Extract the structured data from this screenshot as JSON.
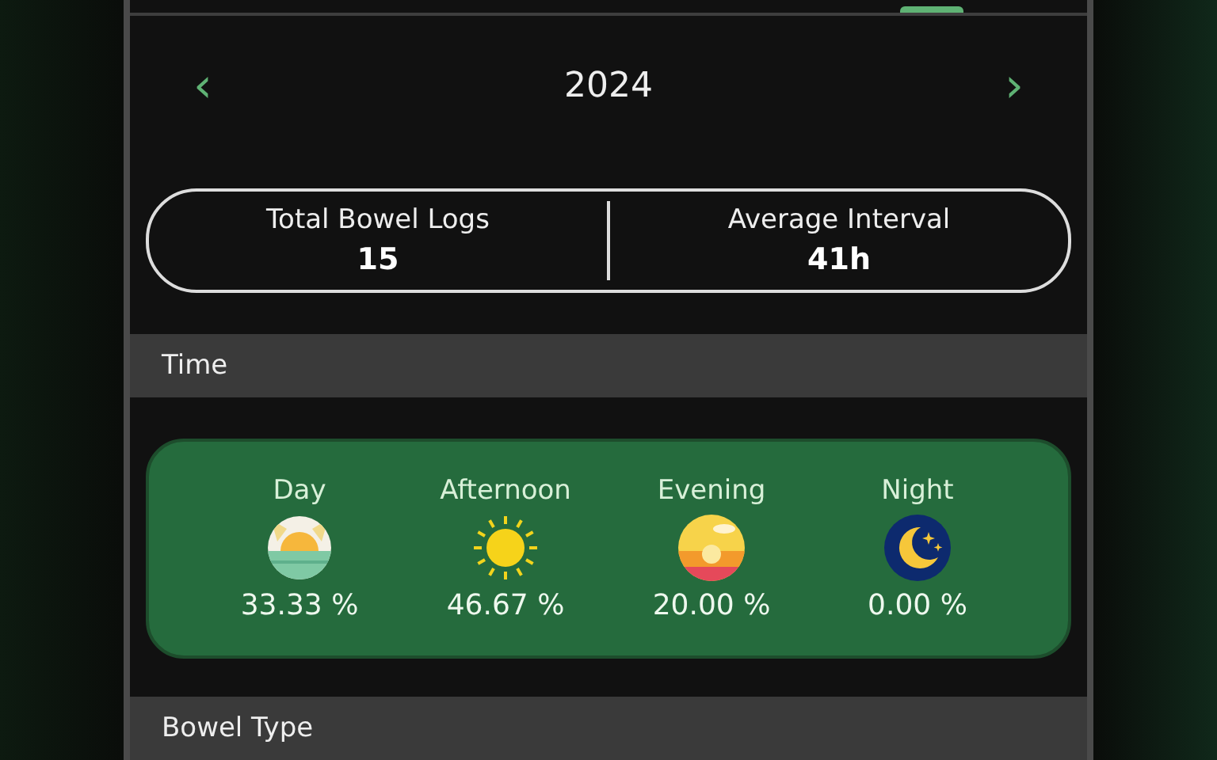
{
  "year_nav": {
    "prev": "‹",
    "year": "2024",
    "next": "›"
  },
  "summary": [
    {
      "label": "Total Bowel Logs",
      "value": "15"
    },
    {
      "label": "Average Interval",
      "value": "41h"
    }
  ],
  "sections": [
    {
      "title": "Time"
    },
    {
      "title": "Bowel Type"
    }
  ],
  "time_of_day": [
    {
      "kind": "sunrise",
      "label": "Day",
      "percent": "33.33 %"
    },
    {
      "kind": "sun",
      "label": "Afternoon",
      "percent": "46.67 %"
    },
    {
      "kind": "sunset",
      "label": "Evening",
      "percent": "20.00 %"
    },
    {
      "kind": "moon",
      "label": "Night",
      "percent": "0.00 %"
    }
  ]
}
